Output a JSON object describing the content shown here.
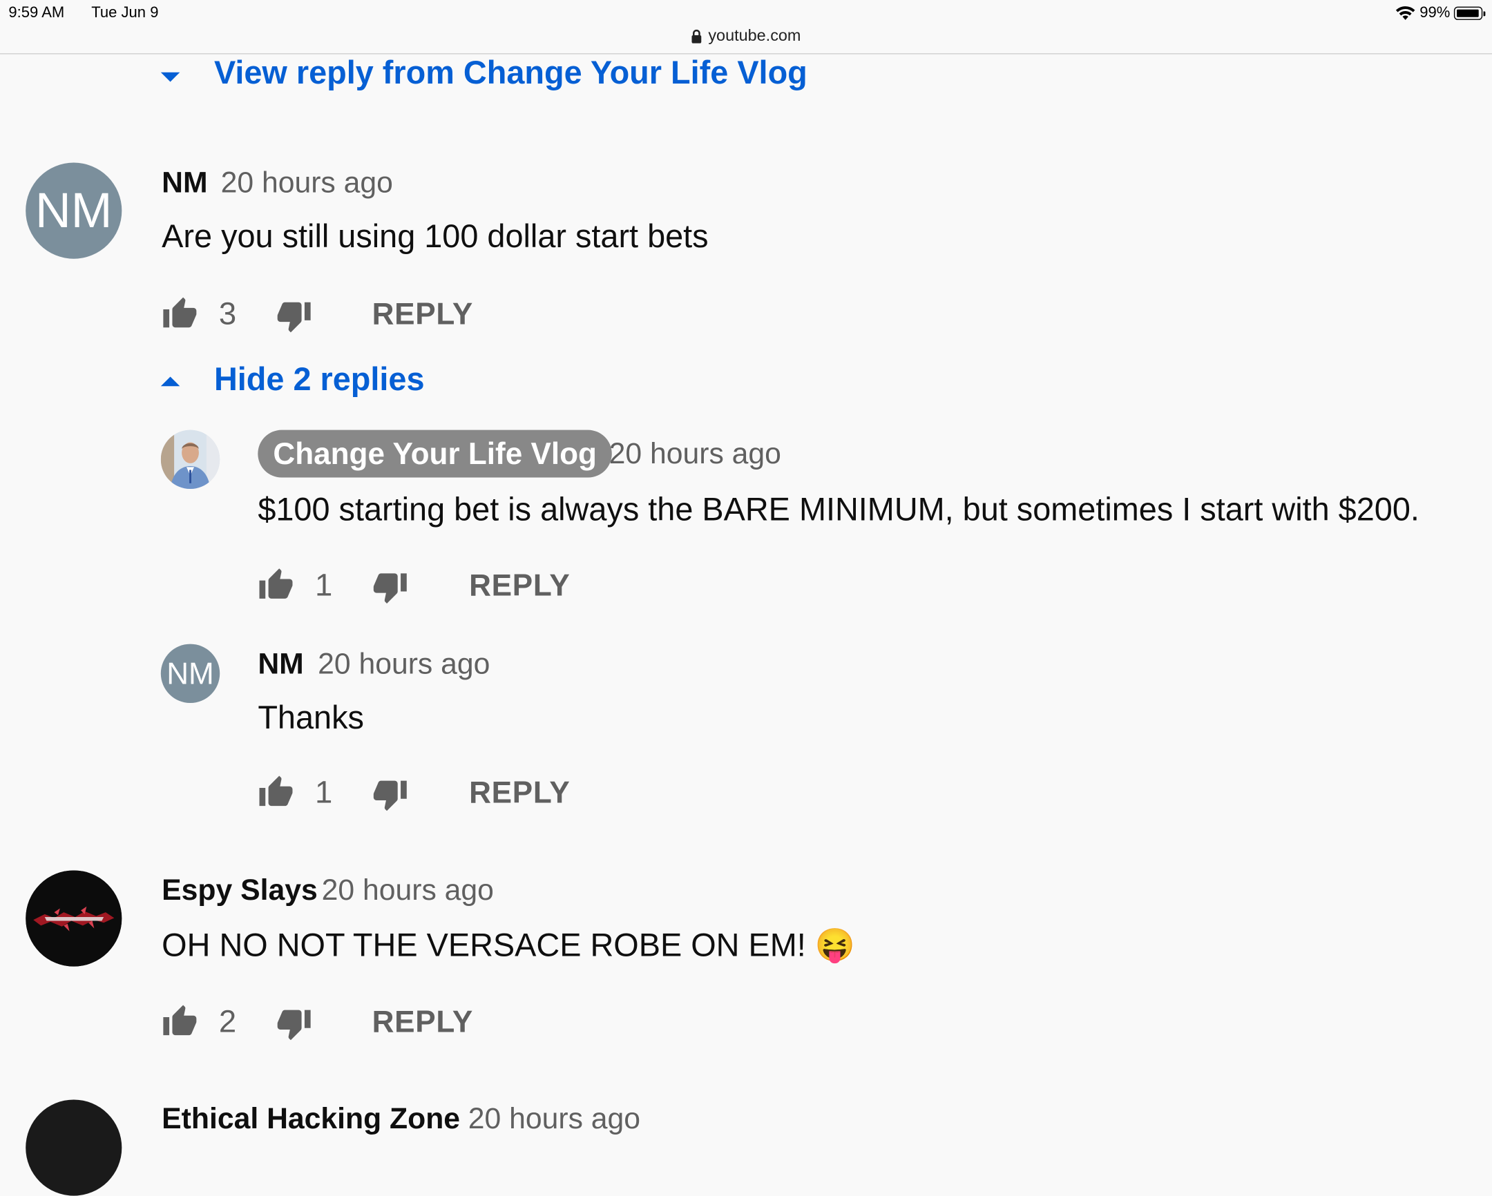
{
  "status_bar": {
    "time": "9:59 AM",
    "date": "Tue Jun 9",
    "battery": "99%",
    "battery_level": 0.99
  },
  "browser": {
    "url": "youtube.com"
  },
  "view_reply_link": "View reply from Change Your Life Vlog",
  "comments": [
    {
      "avatar_text": "NM",
      "author": "NM",
      "time": "20 hours ago",
      "text": "Are you still using 100 dollar start bets",
      "likes": "3",
      "reply_label": "REPLY"
    },
    {
      "avatar_text": "",
      "author": "Espy Slays",
      "time": "20 hours ago",
      "text": "OH NO NOT THE VERSACE ROBE ON EM!",
      "emoji": "😝",
      "likes": "2",
      "reply_label": "REPLY"
    }
  ],
  "replies_toggle": "Hide 2 replies",
  "replies": [
    {
      "avatar_text": "",
      "author": "Change Your Life Vlog",
      "time": "20 hours ago",
      "text": "$100 starting bet is always the BARE MINIMUM, but sometimes I start with $200.",
      "likes": "1",
      "reply_label": "REPLY"
    },
    {
      "avatar_text": "NM",
      "author": "NM",
      "time": "20 hours ago",
      "text": "Thanks",
      "likes": "1",
      "reply_label": "REPLY"
    }
  ],
  "next_comment": {
    "author": "Ethical Hacking Zone",
    "time": "20 hours ago"
  },
  "colors": {
    "link_blue": "#065fd4",
    "avatar_nm": "#7b8f9c",
    "pill_gray": "#888888",
    "background": "#f9f9f9"
  }
}
